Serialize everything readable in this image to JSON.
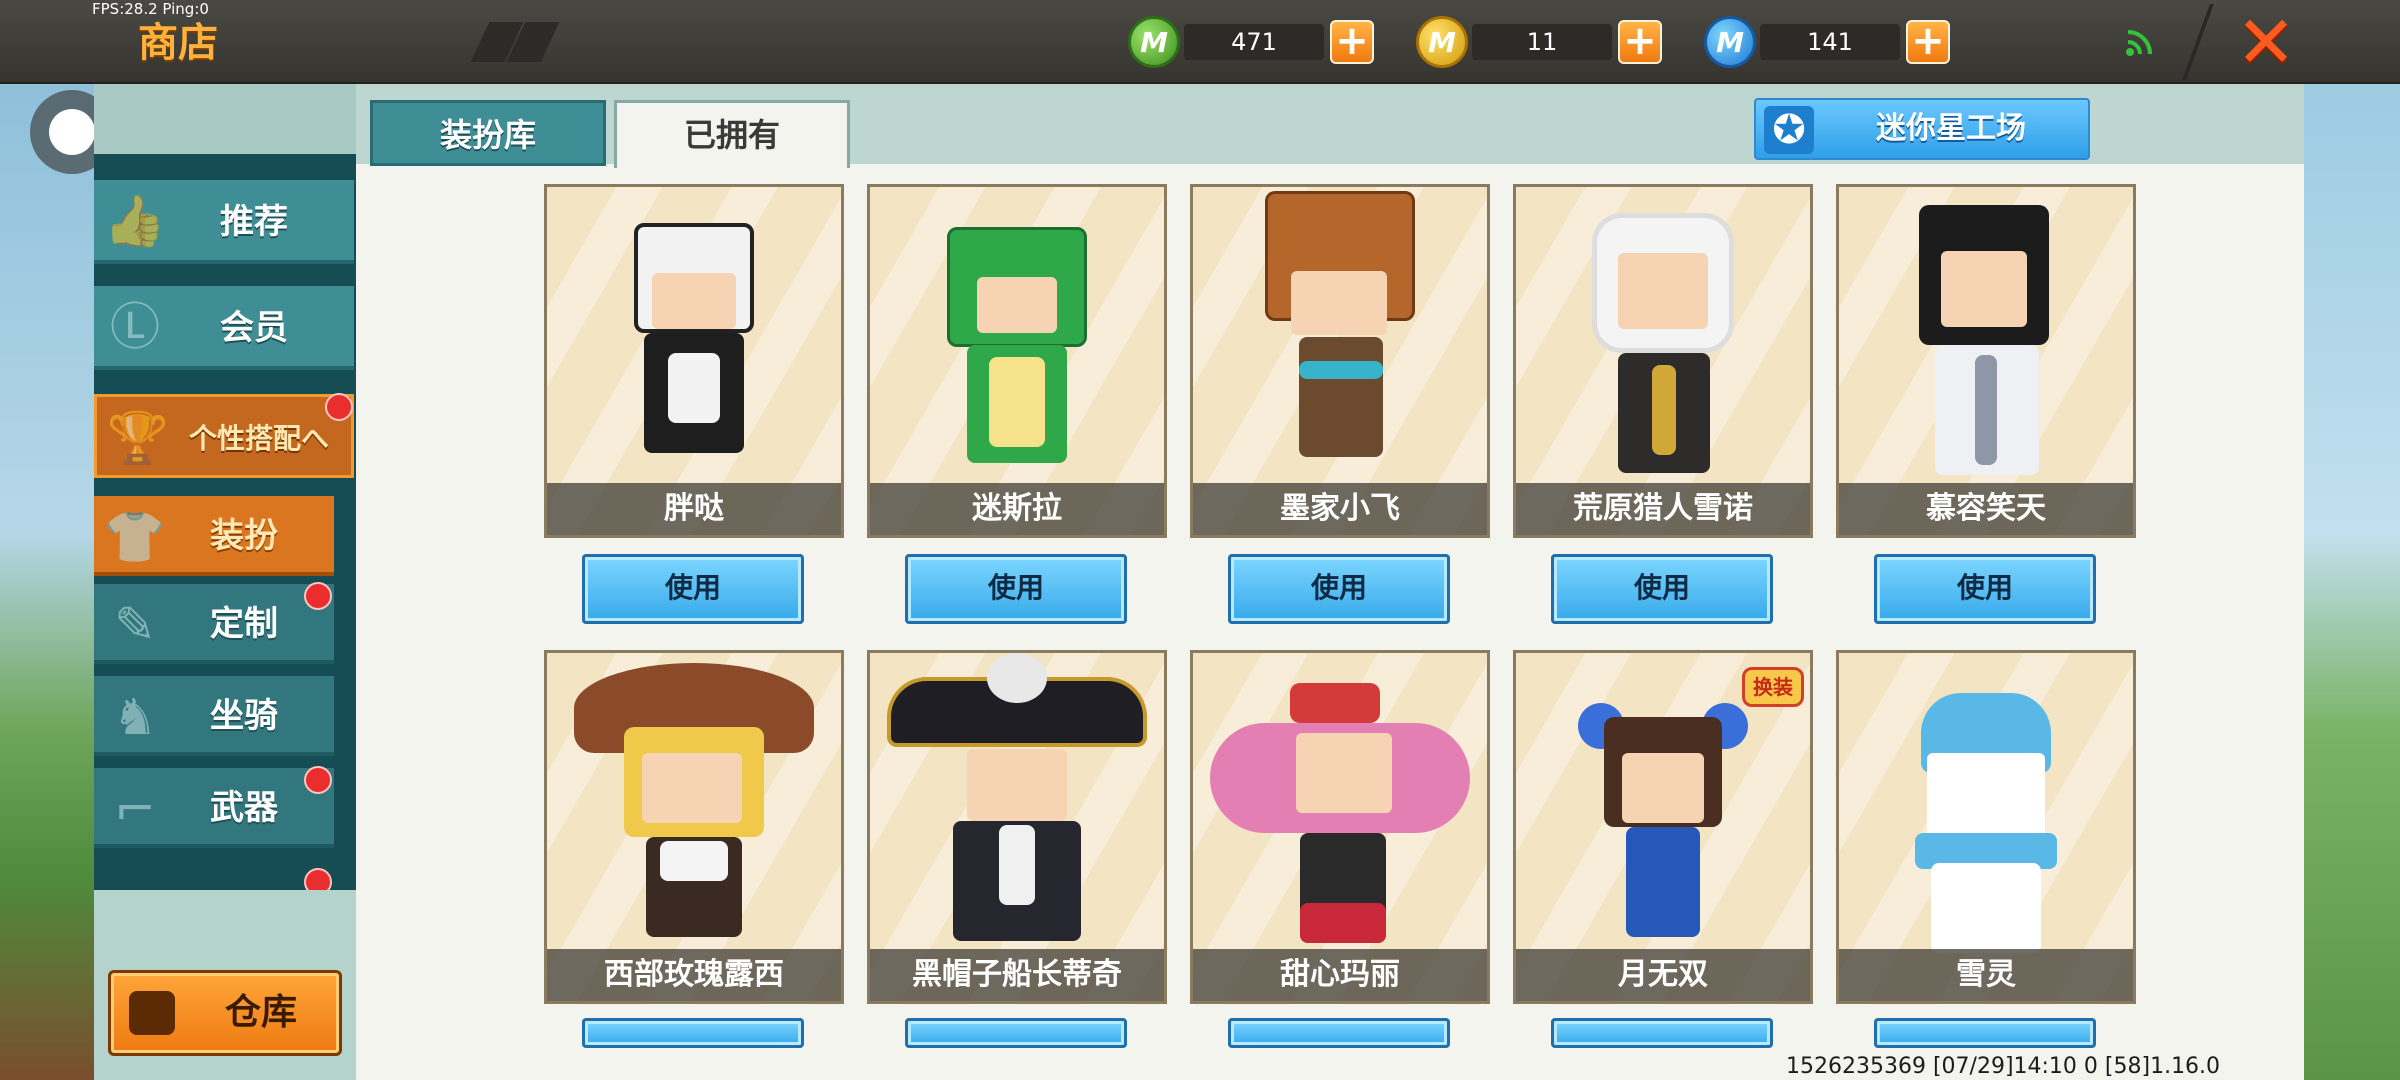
{
  "hud": {
    "fps": "FPS:28.2  Ping:0"
  },
  "header": {
    "title": "商店"
  },
  "currencies": [
    {
      "icon": "mini-bean-icon",
      "color": "#3d8f1e",
      "amount": "471",
      "glyph": "M"
    },
    {
      "icon": "mini-coin-icon",
      "color": "#d29a0c",
      "amount": "11",
      "glyph": "M"
    },
    {
      "icon": "mini-point-icon",
      "color": "#1e78d2",
      "amount": "141",
      "glyph": "M"
    }
  ],
  "sidebar": {
    "items": [
      {
        "label": "推荐",
        "icon": "thumbs-up-icon"
      },
      {
        "label": "会员",
        "icon": "vip-icon"
      },
      {
        "label": "个性搭配へ",
        "icon": "trophy-icon",
        "badge": true
      },
      {
        "label": "装扮",
        "icon": "shirt-icon",
        "active": true
      },
      {
        "label": "定制",
        "icon": "pencil-icon",
        "badge": true
      },
      {
        "label": "坐骑",
        "icon": "mount-icon"
      },
      {
        "label": "武器",
        "icon": "gun-icon",
        "badge": true
      }
    ],
    "warehouse_label": "仓库"
  },
  "tabs": [
    {
      "label": "装扮库",
      "selected": false
    },
    {
      "label": "已拥有",
      "selected": true
    }
  ],
  "workshop_label": "迷你星工场",
  "use_label": "使用",
  "skins": [
    {
      "name": "胖哒"
    },
    {
      "name": "迷斯拉"
    },
    {
      "name": "墨家小飞"
    },
    {
      "name": "荒原猎人雪诺"
    },
    {
      "name": "慕容笑天"
    },
    {
      "name": "西部玫瑰露西"
    },
    {
      "name": "黑帽子船长蒂奇"
    },
    {
      "name": "甜心玛丽"
    },
    {
      "name": "月无双",
      "tag": "换装"
    },
    {
      "name": "雪灵"
    }
  ],
  "footer": {
    "info": "1526235369   [07/29]14:10 0   [58]1.16.0"
  }
}
